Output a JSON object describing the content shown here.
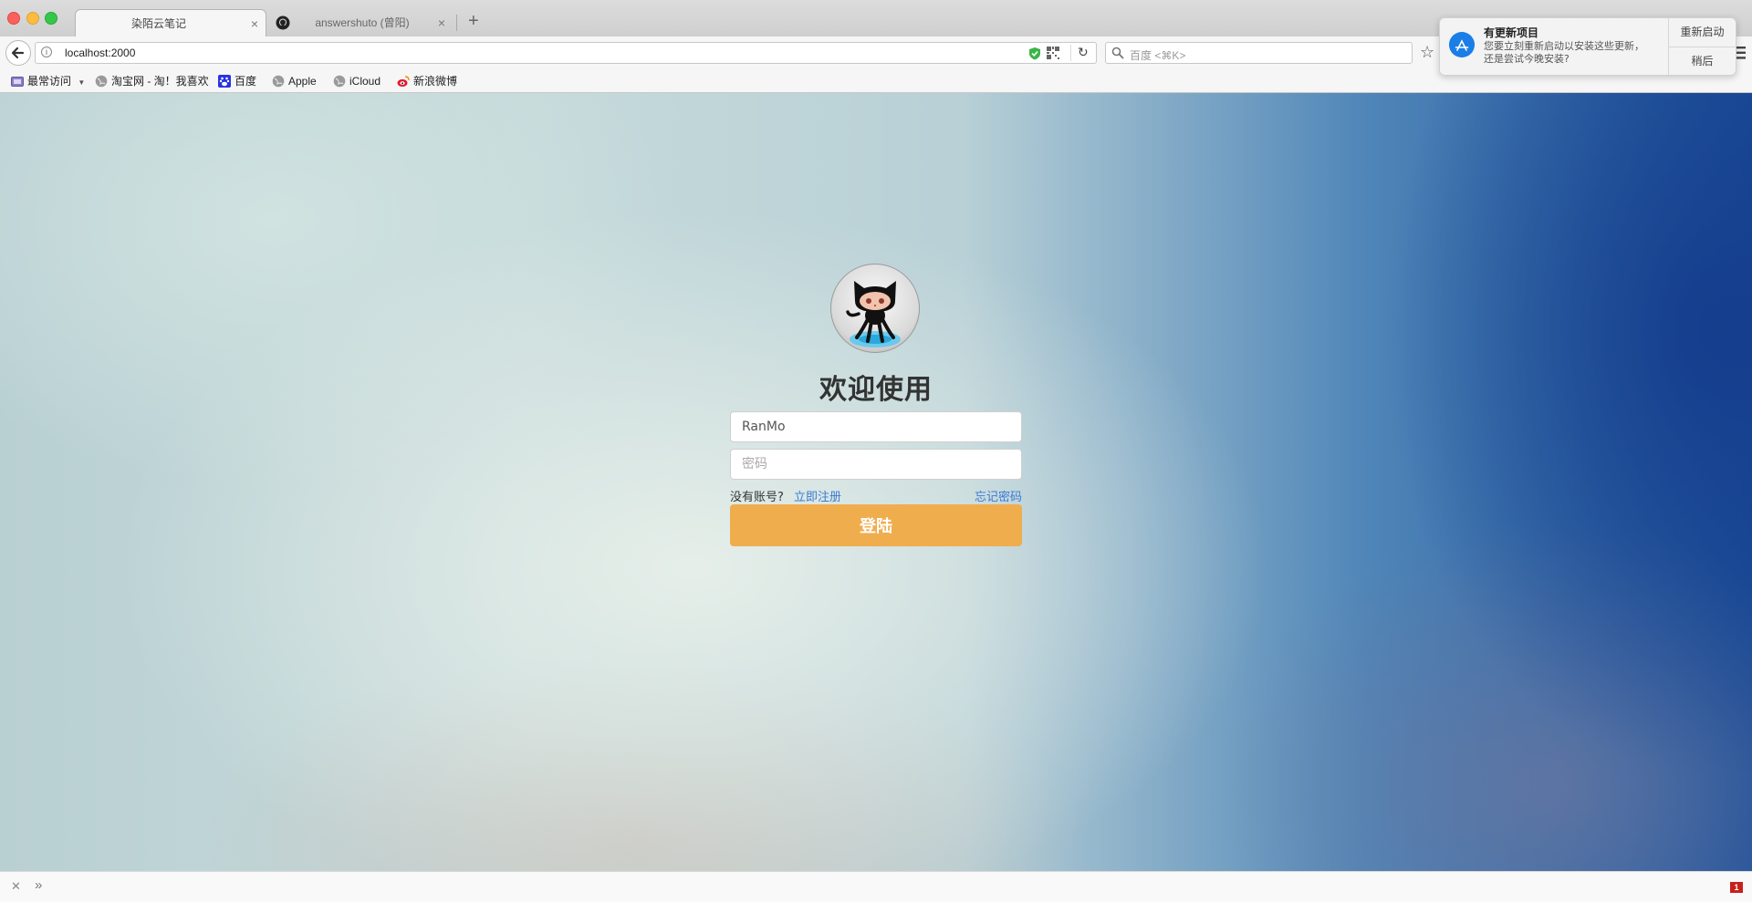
{
  "browser": {
    "tabs": [
      {
        "title": "染陌云笔记",
        "active": true
      },
      {
        "title": "answershuto (曾阳)",
        "active": false
      }
    ],
    "new_tab": "+",
    "close_glyph": "×",
    "url": "localhost:2000",
    "search_placeholder": "百度 <⌘K>",
    "bookmarks": [
      {
        "label": "最常访问",
        "icon": "folder-icon"
      },
      {
        "label": "淘宝网 - 淘！我喜欢",
        "icon": "globe-icon"
      },
      {
        "label": "百度",
        "icon": "baidu-icon"
      },
      {
        "label": "Apple",
        "icon": "globe-icon"
      },
      {
        "label": "iCloud",
        "icon": "globe-icon"
      },
      {
        "label": "新浪微博",
        "icon": "weibo-icon"
      }
    ]
  },
  "notification": {
    "title": "有更新项目",
    "body": "您要立刻重新启动以安装这些更新，还是尝试今晚安装?",
    "restart_label": "重新启动",
    "later_label": "稍后"
  },
  "login": {
    "welcome": "欢迎使用",
    "username_value": "RanMo",
    "password_placeholder": "密码",
    "no_account": "没有账号?",
    "register_link": "立即注册",
    "forgot_link": "忘记密码",
    "submit_label": "登陆"
  },
  "statusbar": {
    "badge": "1"
  },
  "colors": {
    "accent": "#f0ad4e",
    "link": "#3a7bd5"
  }
}
